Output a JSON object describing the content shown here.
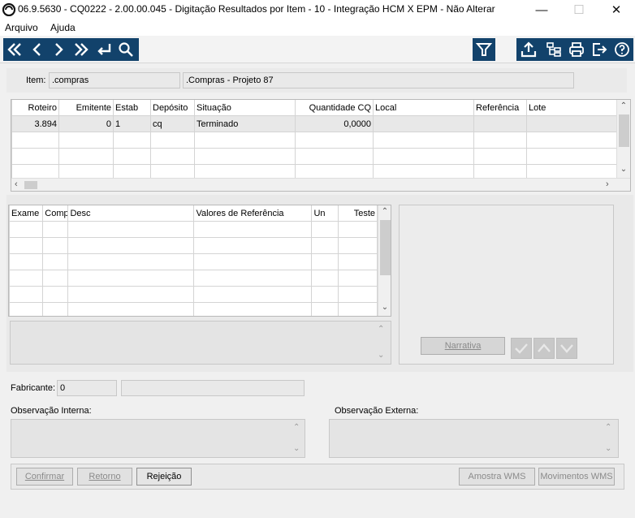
{
  "window": {
    "title": "06.9.5630 - CQ0222 - 2.00.00.045 - Digitação Resultados por Item - 10 - Integração HCM X EPM - Não Alterar",
    "minimize": "—",
    "maximize": "☐",
    "close": "✕"
  },
  "menu": {
    "items": [
      "Arquivo",
      "Ajuda"
    ]
  },
  "toolbar": {
    "nav_icons": [
      "first-icon",
      "previous-icon",
      "next-icon",
      "last-icon",
      "goto-icon",
      "search-icon"
    ],
    "right_icons": [
      "filter-icon",
      "export-icon",
      "tree-icon",
      "print-icon",
      "exit-icon",
      "help-icon"
    ],
    "color": "#12426b"
  },
  "item": {
    "label": "Item:",
    "code": ".compras",
    "description": ".Compras - Projeto 87"
  },
  "grid1": {
    "headers": [
      "Roteiro",
      "Emitente",
      "Estab",
      "Depósito",
      "Situação",
      "Quantidade CQ",
      "Local",
      "Referência",
      "Lote"
    ],
    "rows": [
      [
        "3.894",
        "0",
        "1",
        "cq",
        "Terminado",
        "0,0000",
        "",
        "",
        ""
      ]
    ]
  },
  "grid2": {
    "headers": [
      "Exame",
      "Comp",
      "Desc",
      "Valores de Referência",
      "Un",
      "Teste"
    ]
  },
  "buttons": {
    "narrativa": "Narrativa",
    "confirmar": "Confirmar",
    "retorno": "Retorno",
    "rejeicao": "Rejeição",
    "amostra_wms": "Amostra WMS",
    "movimentos_wms": "Movimentos WMS"
  },
  "fabricante": {
    "label": "Fabricante:",
    "code": "0",
    "name": ""
  },
  "obs": {
    "interna_label": "Observação Interna:",
    "externa_label": "Observação Externa:"
  }
}
